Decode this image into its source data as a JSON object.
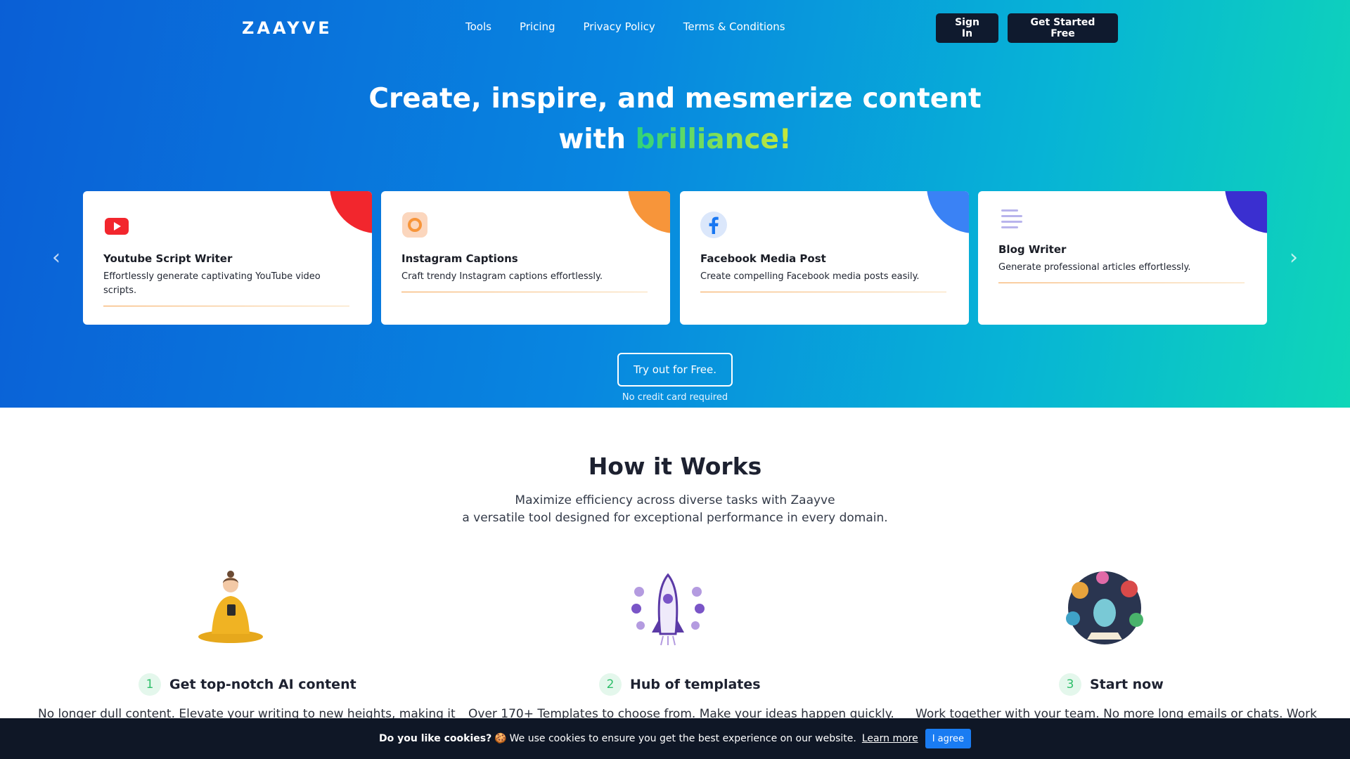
{
  "nav": {
    "logo": "ZAAYVE",
    "links": [
      "Tools",
      "Pricing",
      "Privacy Policy",
      "Terms & Conditions"
    ],
    "sign_in": "Sign In",
    "get_started": "Get Started Free"
  },
  "hero": {
    "title_line1": "Create, inspire, and mesmerize content",
    "title_line2_prefix": "with",
    "title_highlight": "brilliance!",
    "try_button": "Try out for Free.",
    "no_credit": "No credit card required"
  },
  "cards": [
    {
      "title": "Youtube Script Writer",
      "desc": "Effortlessly generate captivating YouTube video scripts.",
      "icon": "youtube-icon",
      "accent": "#f2262d"
    },
    {
      "title": "Instagram Captions",
      "desc": "Craft trendy Instagram captions effortlessly.",
      "icon": "instagram-icon",
      "accent": "#f7953a"
    },
    {
      "title": "Facebook Media Post",
      "desc": "Create compelling Facebook media posts easily.",
      "icon": "facebook-icon",
      "accent": "#3a82f5"
    },
    {
      "title": "Blog Writer",
      "desc": "Generate professional articles effortlessly.",
      "icon": "blog-lines-icon",
      "accent": "#3a2fd0"
    }
  ],
  "how": {
    "title": "How it Works",
    "subtitle_line1": "Maximize efficiency across diverse tasks with Zaayve",
    "subtitle_line2": "a versatile tool designed for exceptional performance in every domain.",
    "steps": [
      {
        "num": "1",
        "title": "Get top-notch AI content",
        "desc": "No longer dull content. Elevate your writing to new heights, making it"
      },
      {
        "num": "2",
        "title": "Hub of templates",
        "desc": "Over 170+ Templates to choose from. Make your ideas happen quickly."
      },
      {
        "num": "3",
        "title": "Start now",
        "desc": "Work together with your team. No more long emails or chats. Work"
      }
    ]
  },
  "cookie": {
    "question": "Do you like cookies?",
    "text": "We use cookies to ensure you get the best experience on our website.",
    "learn_more": "Learn more",
    "agree": "I agree"
  },
  "colors": {
    "hero_start": "#0a5fd6",
    "hero_end": "#0fd6b8",
    "dark_button": "#0f1a2e",
    "cookie_bar": "#0f1726",
    "agree_button": "#1a7cf2",
    "step_number": "#2fbf6a"
  }
}
